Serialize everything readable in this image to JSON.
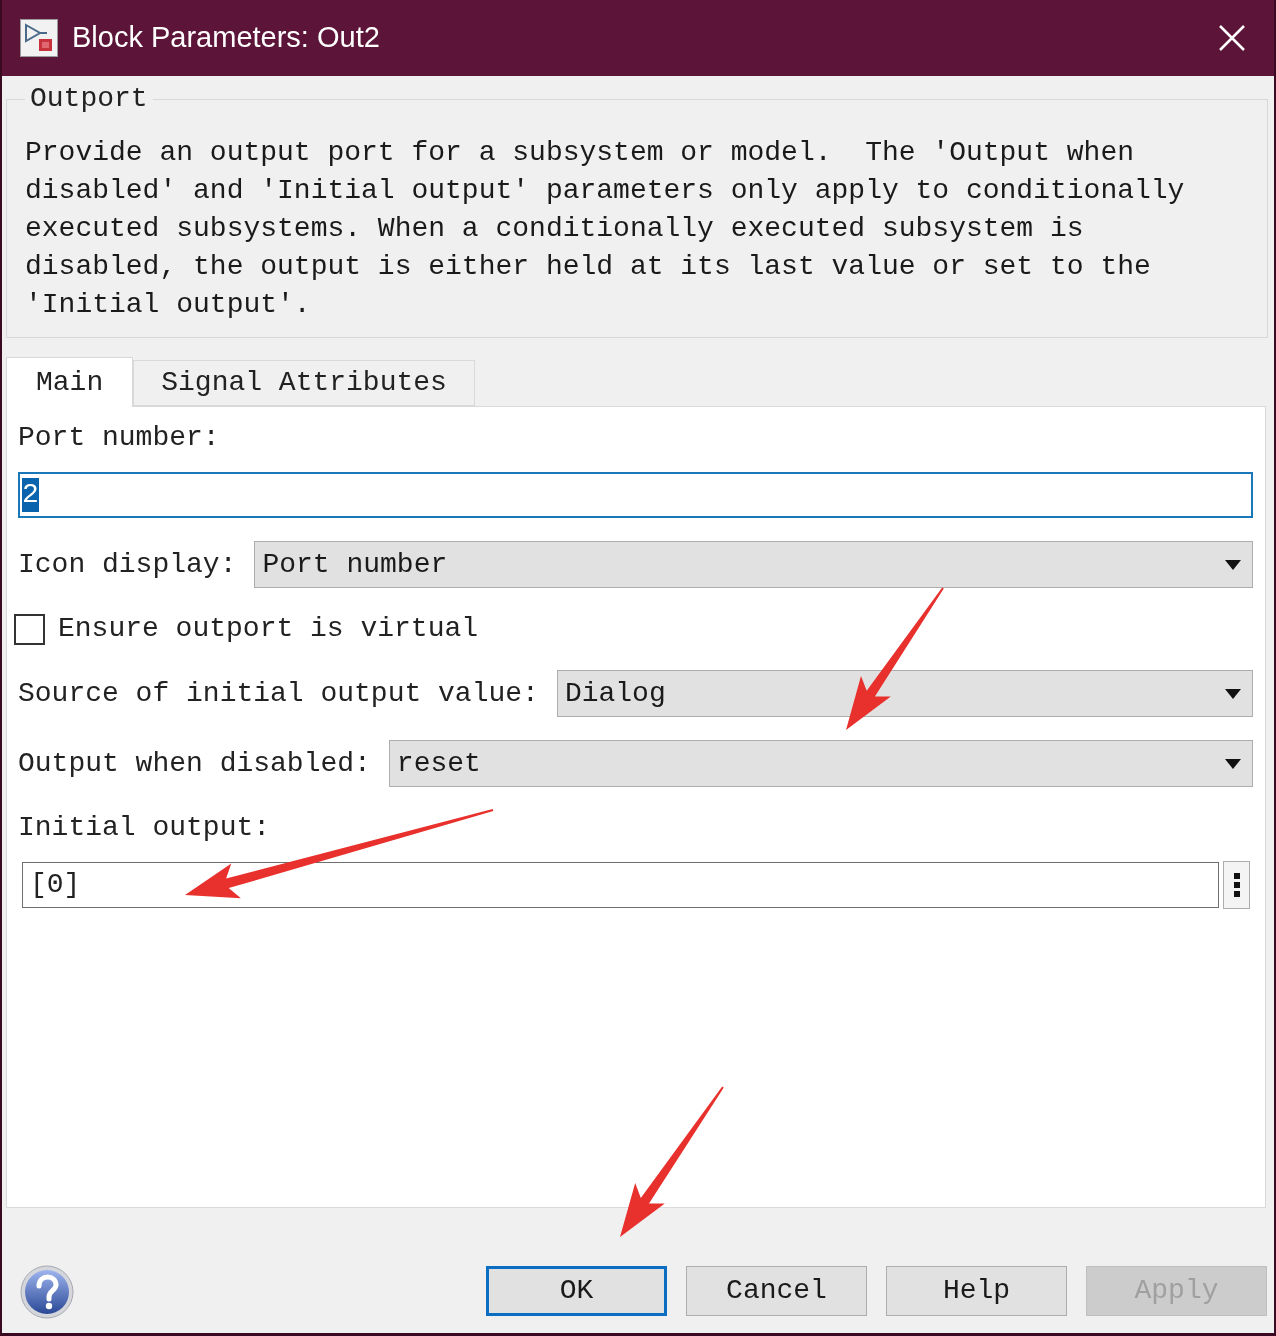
{
  "window": {
    "title": "Block Parameters: Out2"
  },
  "group": {
    "title": "Outport",
    "description": "Provide an output port for a subsystem or model.  The 'Output when disabled' and 'Initial output' parameters only apply to conditionally executed subsystems. When a conditionally executed subsystem is disabled, the output is either held at its last value or set to the 'Initial output'."
  },
  "tabs": [
    {
      "label": "Main",
      "selected": true
    },
    {
      "label": "Signal Attributes",
      "selected": false
    }
  ],
  "fields": [
    {
      "kind": "text",
      "label": "Port number:",
      "value": "2",
      "focused": true
    },
    {
      "kind": "dropdown",
      "label": "Icon display:",
      "value": "Port number"
    },
    {
      "kind": "checkbox",
      "label": "Ensure outport is virtual",
      "checked": false
    },
    {
      "kind": "dropdown",
      "label": "Source of initial output value:",
      "value": "Dialog"
    },
    {
      "kind": "dropdown",
      "label": "Output when disabled:",
      "value": "reset"
    },
    {
      "kind": "text_with_menu",
      "label": "Initial output:",
      "value": "[0]",
      "focused": false
    }
  ],
  "buttons": [
    {
      "label": "OK",
      "default": true,
      "disabled": false
    },
    {
      "label": "Cancel",
      "default": false,
      "disabled": false
    },
    {
      "label": "Help",
      "default": false,
      "disabled": false
    },
    {
      "label": "Apply",
      "default": false,
      "disabled": true
    }
  ]
}
